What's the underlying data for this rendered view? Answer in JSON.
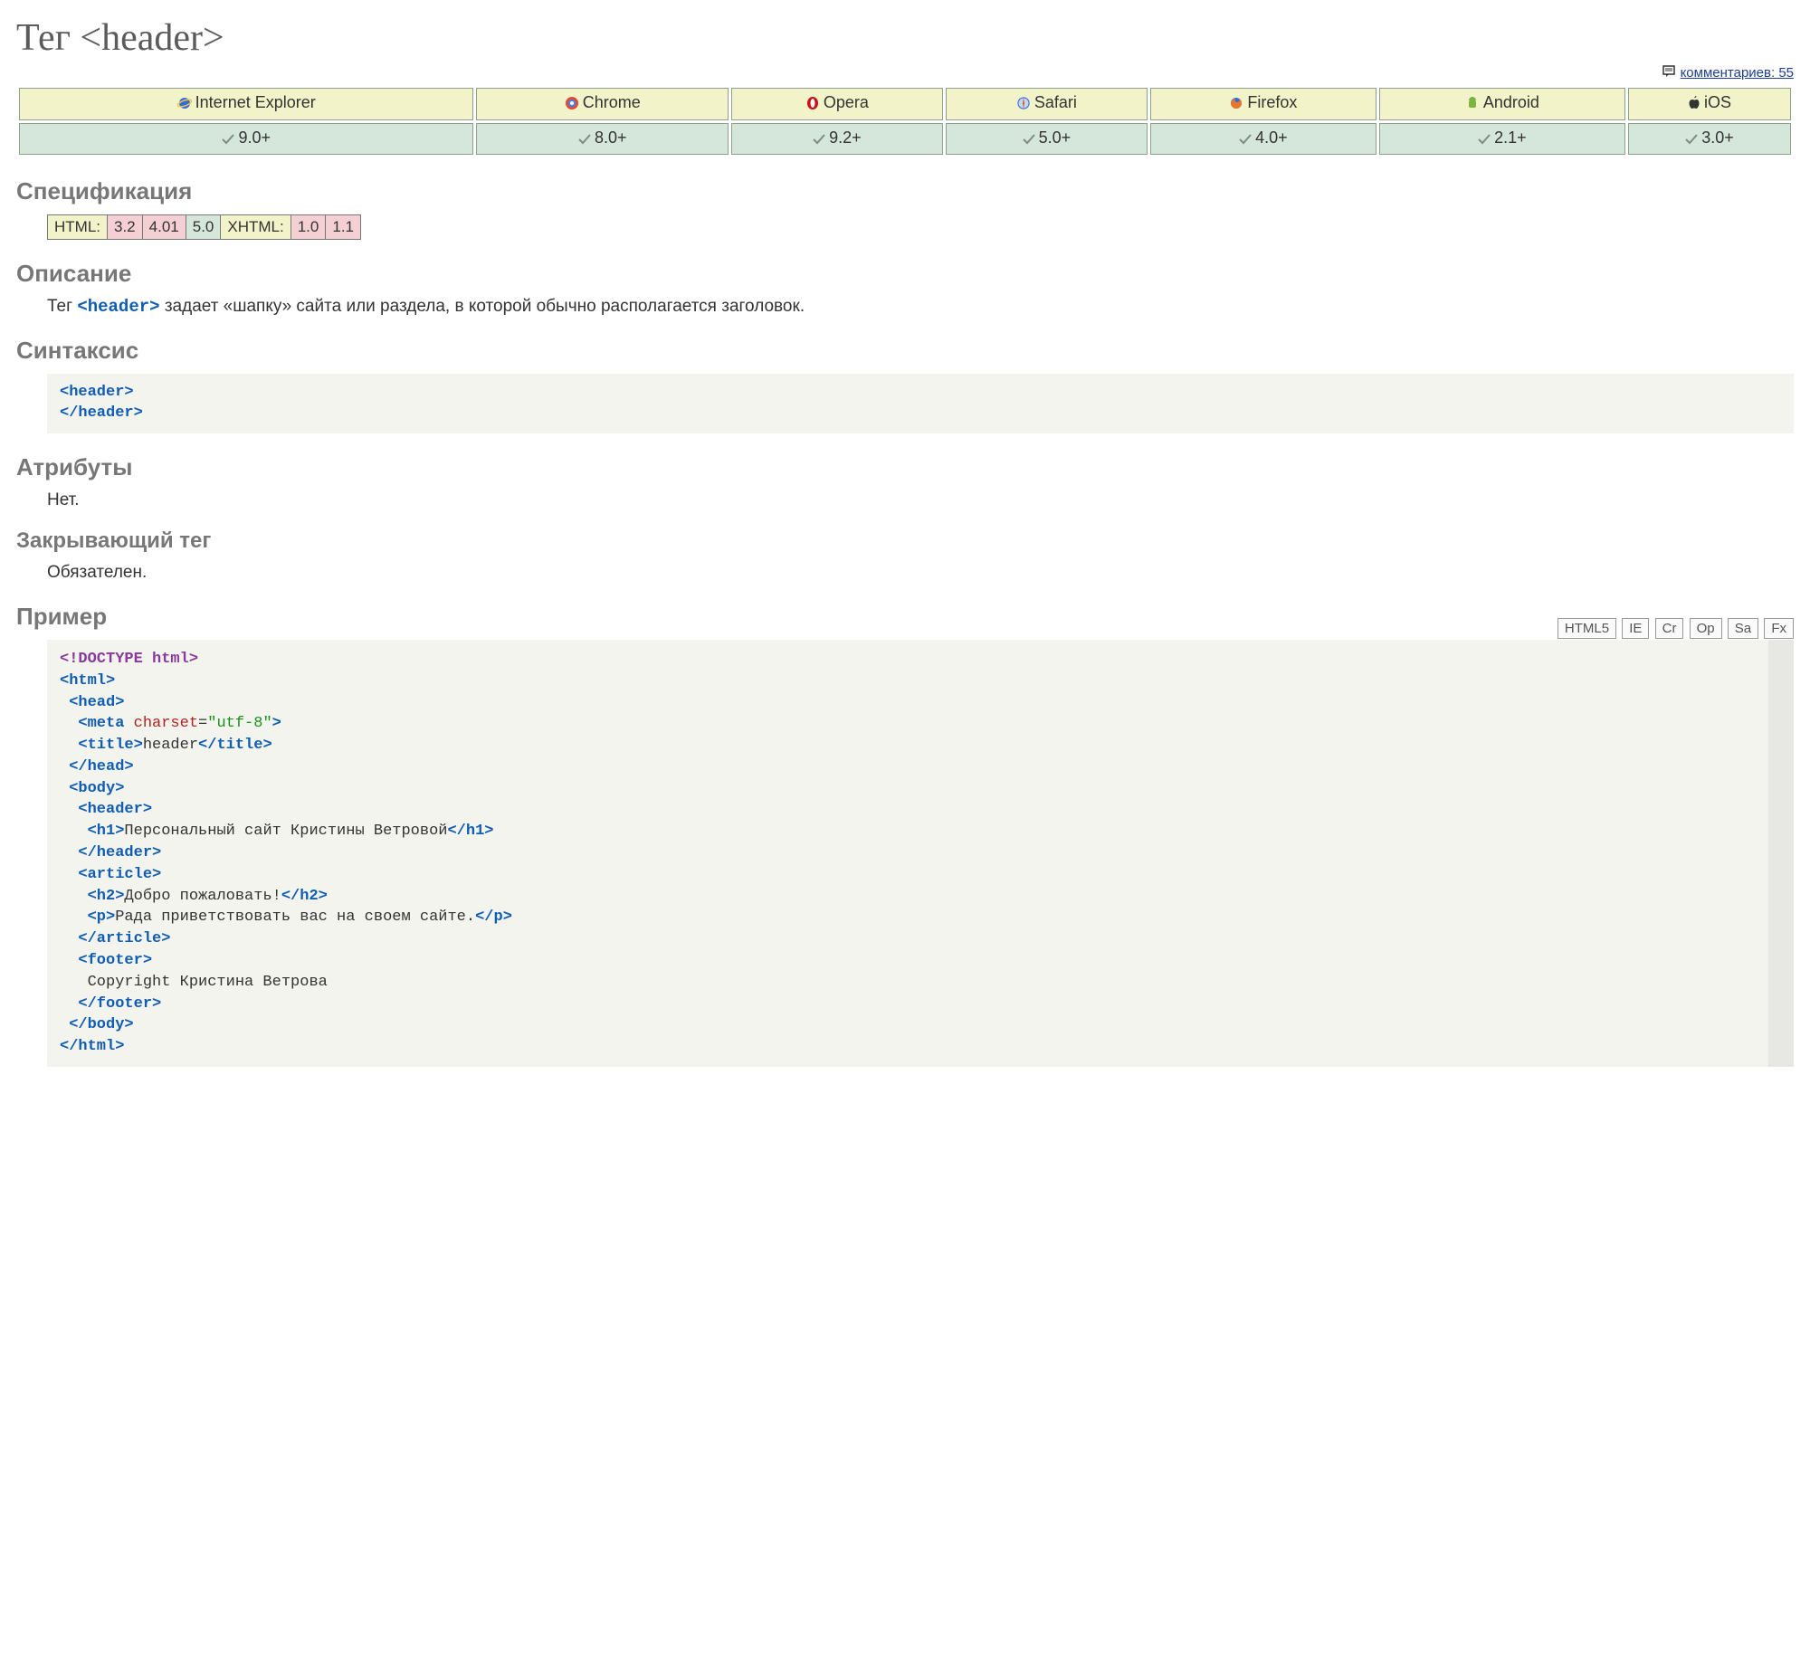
{
  "title": "Тег <header>",
  "comments": {
    "label": "комментариев: 55"
  },
  "browsers": {
    "headers": [
      "Internet Explorer",
      "Chrome",
      "Opera",
      "Safari",
      "Firefox",
      "Android",
      "iOS"
    ],
    "values": [
      "9.0+",
      "8.0+",
      "9.2+",
      "5.0+",
      "4.0+",
      "2.1+",
      "3.0+"
    ]
  },
  "sections": {
    "spec": "Спецификация",
    "desc": "Описание",
    "syntax": "Синтаксис",
    "attrs": "Атрибуты",
    "close": "Закрывающий тег",
    "ex": "Пример"
  },
  "spec": {
    "html_label": "HTML:",
    "html": [
      "3.2",
      "4.01",
      "5.0"
    ],
    "xhtml_label": "XHTML:",
    "xhtml": [
      "1.0",
      "1.1"
    ]
  },
  "desc": {
    "pre": "Тег ",
    "tag": "<header>",
    "post": " задает «шапку» сайта или раздела, в которой обычно располагается заголовок."
  },
  "syntax_code": "<header>\n</header>",
  "attrs_text": "Нет.",
  "close_text": "Обязателен.",
  "example_labels": [
    "HTML5",
    "IE",
    "Cr",
    "Op",
    "Sa",
    "Fx"
  ],
  "example": {
    "doctype": "<!DOCTYPE html>",
    "open_html": "<html>",
    "open_head": " <head>",
    "meta": "  <meta ",
    "meta_attr": "charset",
    "meta_eq": "=",
    "meta_val": "\"utf-8\"",
    "meta_close": ">",
    "title_open": "  <title>",
    "title_text": "header",
    "title_close": "</title>",
    "close_head": " </head>",
    "open_body": " <body>",
    "open_header": "  <header>",
    "h1_open": "   <h1>",
    "h1_text": "Персональный сайт Кристины Ветровой",
    "h1_close": "</h1>",
    "close_header": "  </header>",
    "open_article": "  <article>",
    "h2_open": "   <h2>",
    "h2_text": "Добро пожаловать!",
    "h2_close": "</h2>",
    "p_open": "   <p>",
    "p_text": "Рада приветствовать вас на своем сайте.",
    "p_close": "</p>",
    "close_article": "  </article>",
    "open_footer": "  <footer>",
    "footer_text": "   Copyright Кристина Ветрова",
    "close_footer": "  </footer>",
    "close_body": " </body>",
    "close_html": "</html>"
  }
}
